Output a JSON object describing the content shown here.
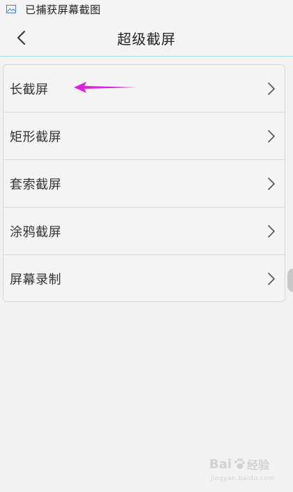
{
  "notification": {
    "icon": "screenshot-image-icon",
    "text": "已捕获屏幕截图"
  },
  "header": {
    "back_icon": "chevron-left-icon",
    "title": "超级截屏"
  },
  "menu": {
    "items": [
      {
        "label": "长截屏",
        "icon": "chevron-right-icon"
      },
      {
        "label": "矩形截屏",
        "icon": "chevron-right-icon"
      },
      {
        "label": "套索截屏",
        "icon": "chevron-right-icon"
      },
      {
        "label": "涂鸦截屏",
        "icon": "chevron-right-icon"
      },
      {
        "label": "屏幕录制",
        "icon": "chevron-right-icon"
      }
    ]
  },
  "annotation": {
    "icon": "pointer-arrow-icon",
    "color": "#e020e0"
  },
  "watermark": {
    "brand": "Bai",
    "brand_suffix": "经验",
    "url": "jingyan.baidu.com"
  },
  "colors": {
    "background": "#f2f2f2",
    "header_divider": "#a8dcef",
    "annotation_arrow": "#e020e0"
  }
}
